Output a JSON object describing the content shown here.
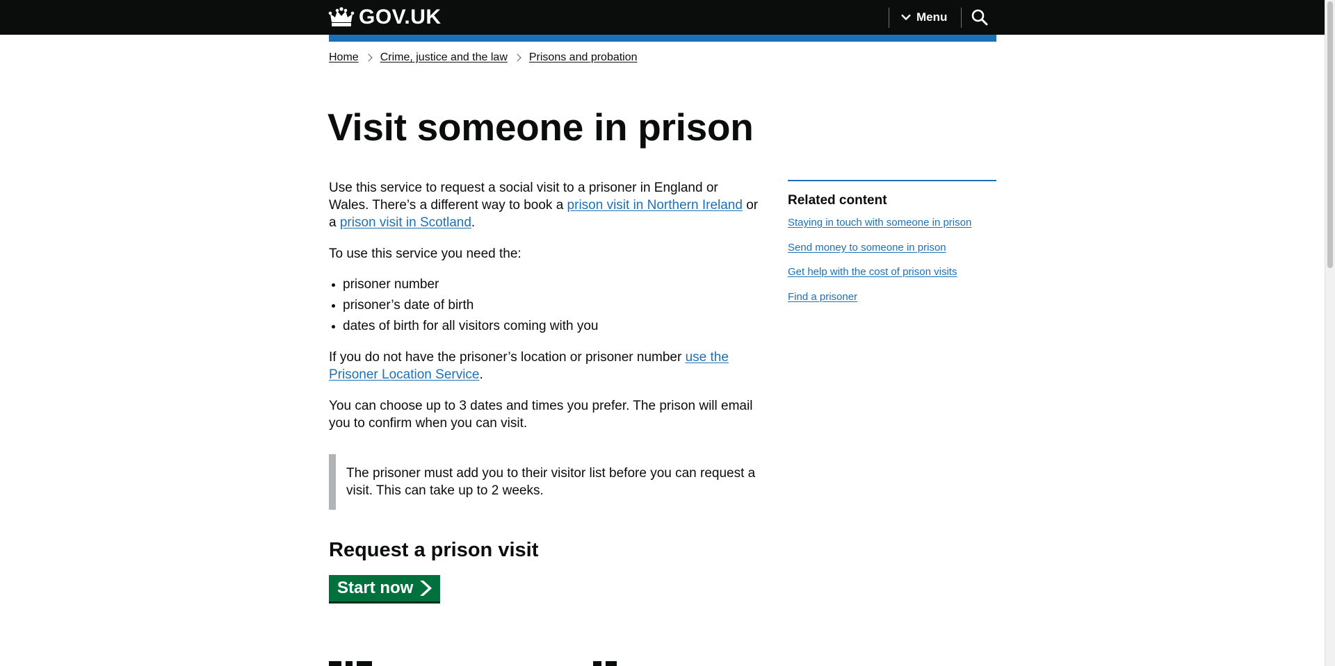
{
  "header": {
    "logo_text": "GOV.UK",
    "menu_label": "Menu",
    "accent_color": "#1d70b8",
    "icons": [
      "crown-icon",
      "chevron-down-icon",
      "search-icon"
    ]
  },
  "breadcrumb": [
    "Home",
    "Crime, justice and the law",
    "Prisons and probation"
  ],
  "page_title": "Visit someone in prison",
  "intro": {
    "text1": "Use this service to request a social visit to a prisoner in England or Wales. There’s a different way to book a ",
    "link1": "prison visit in Northern Ireland",
    "text2": " or a ",
    "link2": "prison visit in Scotland",
    "text3": "."
  },
  "need_intro": "To use this service you need the:",
  "needs": [
    "prisoner number",
    "prisoner’s date of birth",
    "dates of birth for all visitors coming with you"
  ],
  "location": {
    "text": "If you do not have the prisoner’s location or prisoner number ",
    "link": "use the Prisoner Location Service",
    "end": "."
  },
  "choose_text": "You can choose up to 3 dates and times you prefer. The prison will email you to confirm when you can visit.",
  "inset_text": "The prisoner must add you to their visitor list before you can request a visit. This can take up to 2 weeks.",
  "request_heading": "Request a prison visit",
  "start_button": "Start now",
  "related": {
    "title": "Related content",
    "links": [
      "Staying in touch with someone in prison",
      "Send money to someone in prison",
      "Get help with the cost of prison visits",
      "Find a prisoner"
    ]
  },
  "colors": {
    "header_bg": "#0b0c0c",
    "link": "#1d70b8",
    "start_button": "#00703c",
    "inset_border": "#b1b4b6"
  }
}
